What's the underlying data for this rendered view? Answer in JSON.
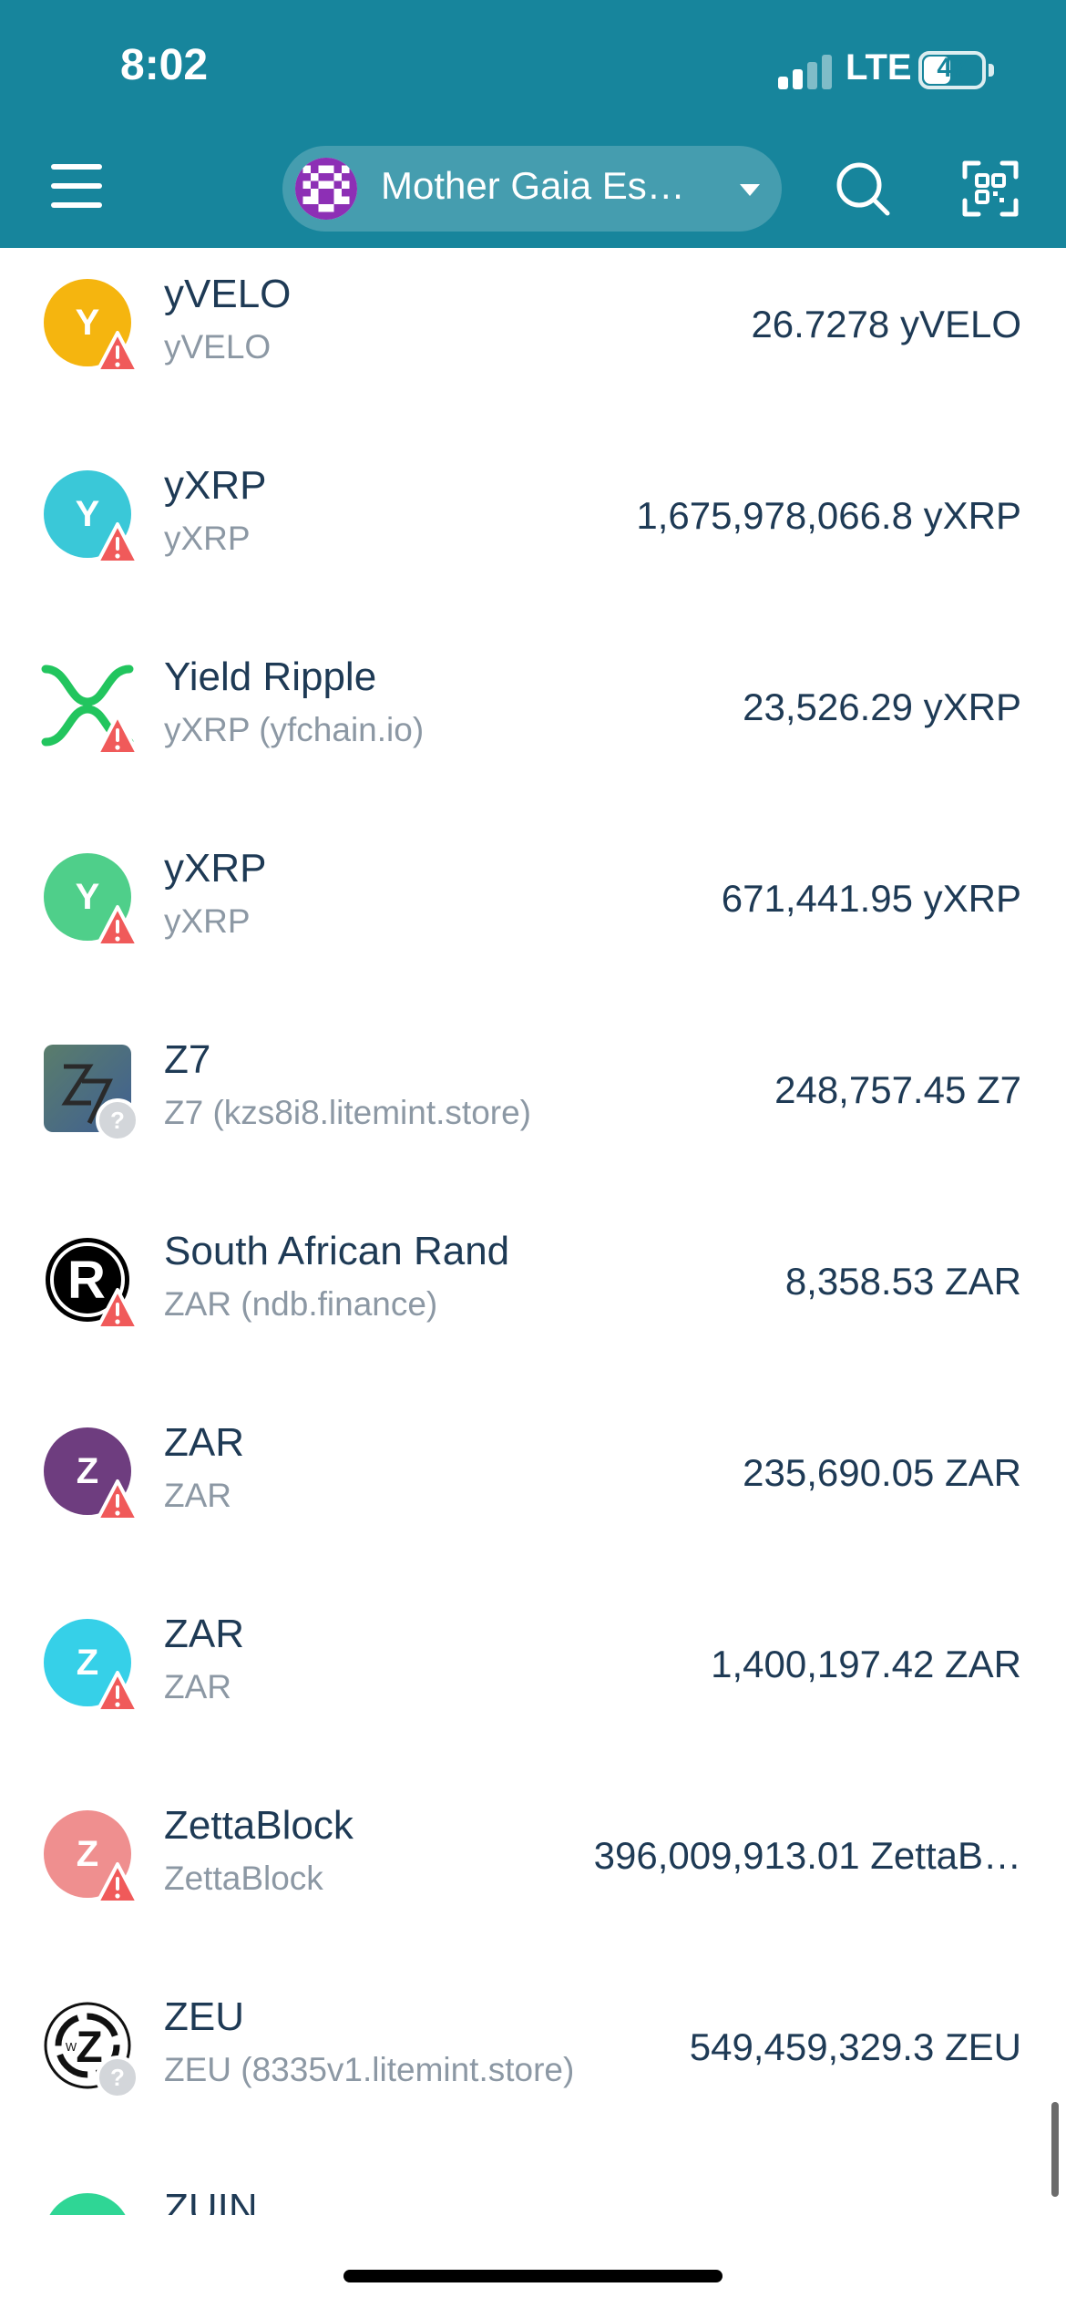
{
  "status_bar": {
    "time": "8:02",
    "network": "LTE",
    "battery": "47",
    "battery_level": 0.47
  },
  "header": {
    "account_name": "Mother Gaia Es…"
  },
  "colors": {
    "header_bg": "#17859c",
    "text_primary": "#1e3a55",
    "text_secondary": "#8c98a4",
    "warning": "#f05a5a"
  },
  "tokens": [
    {
      "name": "yVELO",
      "subtitle": "yVELO",
      "amount": "26.7278 yVELO",
      "icon_letter": "Y",
      "icon_color": "#f5b50f",
      "badge": "warning"
    },
    {
      "name": "yXRP",
      "subtitle": "yXRP",
      "amount": "1,675,978,066.8 yXRP",
      "icon_letter": "Y",
      "icon_color": "#3ac8d8",
      "badge": "warning"
    },
    {
      "name": "Yield Ripple",
      "subtitle": "yXRP (yfchain.io)",
      "amount": "23,526.29 yXRP",
      "icon": "ripple-x-logo",
      "badge": "warning"
    },
    {
      "name": "yXRP",
      "subtitle": "yXRP",
      "amount": "671,441.95 yXRP",
      "icon_letter": "Y",
      "icon_color": "#4fcf8a",
      "badge": "warning"
    },
    {
      "name": "Z7",
      "subtitle": "Z7 (kzs8i8.litemint.store)",
      "amount": "248,757.45 Z7",
      "icon": "z7-logo",
      "badge": "unknown"
    },
    {
      "name": "South African Rand",
      "subtitle": "ZAR (ndb.finance)",
      "amount": "8,358.53 ZAR",
      "icon": "rand-r-logo",
      "badge": "warning"
    },
    {
      "name": "ZAR",
      "subtitle": "ZAR",
      "amount": "235,690.05 ZAR",
      "icon_letter": "Z",
      "icon_color": "#6e3d7f",
      "badge": "warning"
    },
    {
      "name": "ZAR",
      "subtitle": "ZAR",
      "amount": "1,400,197.42 ZAR",
      "icon_letter": "Z",
      "icon_color": "#36d0e8",
      "badge": "warning"
    },
    {
      "name": "ZettaBlock",
      "subtitle": "ZettaBlock",
      "amount": "396,009,913.01 ZettaB…",
      "icon_letter": "Z",
      "icon_color": "#ef8f8f",
      "badge": "warning"
    },
    {
      "name": "ZEU",
      "subtitle": "ZEU (8335v1.litemint.store)",
      "amount": "549,459,329.3 ZEU",
      "icon": "zeu-logo",
      "badge": "unknown"
    },
    {
      "name": "ZUIN",
      "subtitle": "",
      "amount": "",
      "icon_letter": "",
      "icon_color": "#2fd695",
      "badge": "none"
    }
  ]
}
